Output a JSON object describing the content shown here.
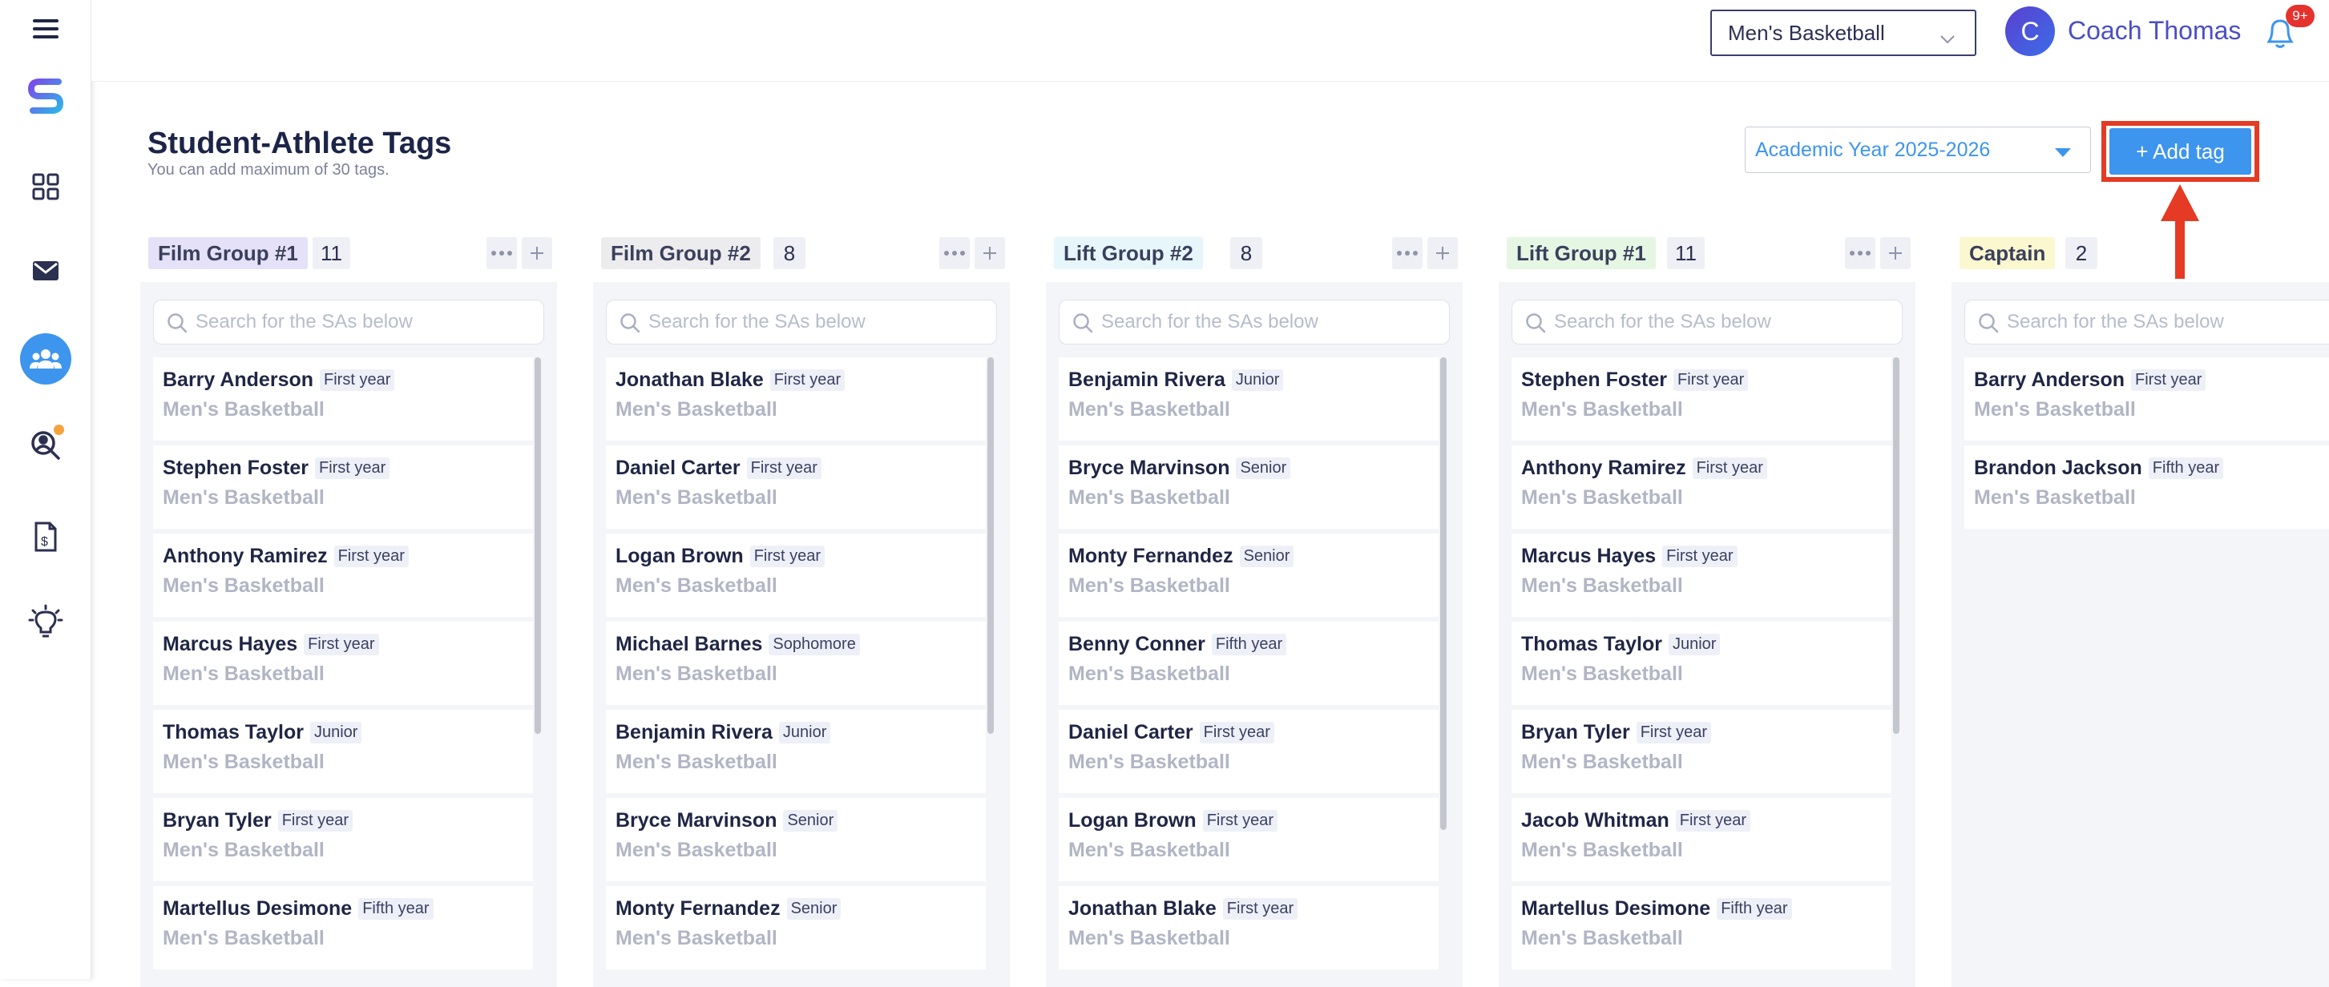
{
  "topbar": {
    "team_select": "Men's Basketball",
    "avatar_initial": "C",
    "user_name": "Coach Thomas",
    "notification_badge": "9+"
  },
  "page": {
    "title": "Student-Athlete Tags",
    "subtitle": "You can add maximum of 30 tags.",
    "year_select": "Academic Year 2025-2026",
    "add_tag_label": "+ Add tag"
  },
  "search_placeholder": "Search for the SAs below",
  "colors": {
    "accent": "#3d95ee",
    "highlight": "#e53a23",
    "tag_film1": "#e4e1f8",
    "tag_film2": "#ecebee",
    "tag_lift2": "#e6f6fb",
    "tag_lift1": "#e5f6e3",
    "tag_captain": "#fbf7cf"
  },
  "columns": [
    {
      "tag": "Film Group #1",
      "count": "11",
      "athletes": [
        {
          "name": "Barry Anderson",
          "year": "First year",
          "team": "Men's Basketball"
        },
        {
          "name": "Stephen Foster",
          "year": "First year",
          "team": "Men's Basketball"
        },
        {
          "name": "Anthony Ramirez",
          "year": "First year",
          "team": "Men's Basketball"
        },
        {
          "name": "Marcus Hayes",
          "year": "First year",
          "team": "Men's Basketball"
        },
        {
          "name": "Thomas Taylor",
          "year": "Junior",
          "team": "Men's Basketball"
        },
        {
          "name": "Bryan Tyler",
          "year": "First year",
          "team": "Men's Basketball"
        },
        {
          "name": "Martellus Desimone",
          "year": "Fifth year",
          "team": "Men's Basketball"
        }
      ]
    },
    {
      "tag": "Film Group #2",
      "count": "8",
      "athletes": [
        {
          "name": "Jonathan Blake",
          "year": "First year",
          "team": "Men's Basketball"
        },
        {
          "name": "Daniel Carter",
          "year": "First year",
          "team": "Men's Basketball"
        },
        {
          "name": "Logan Brown",
          "year": "First year",
          "team": "Men's Basketball"
        },
        {
          "name": "Michael Barnes",
          "year": "Sophomore",
          "team": "Men's Basketball"
        },
        {
          "name": "Benjamin Rivera",
          "year": "Junior",
          "team": "Men's Basketball"
        },
        {
          "name": "Bryce Marvinson",
          "year": "Senior",
          "team": "Men's Basketball"
        },
        {
          "name": "Monty Fernandez",
          "year": "Senior",
          "team": "Men's Basketball"
        }
      ]
    },
    {
      "tag": "Lift Group #2",
      "count": "8",
      "athletes": [
        {
          "name": "Benjamin Rivera",
          "year": "Junior",
          "team": "Men's Basketball"
        },
        {
          "name": "Bryce Marvinson",
          "year": "Senior",
          "team": "Men's Basketball"
        },
        {
          "name": "Monty Fernandez",
          "year": "Senior",
          "team": "Men's Basketball"
        },
        {
          "name": "Benny Conner",
          "year": "Fifth year",
          "team": "Men's Basketball"
        },
        {
          "name": "Daniel Carter",
          "year": "First year",
          "team": "Men's Basketball"
        },
        {
          "name": "Logan Brown",
          "year": "First year",
          "team": "Men's Basketball"
        },
        {
          "name": "Jonathan Blake",
          "year": "First year",
          "team": "Men's Basketball"
        }
      ]
    },
    {
      "tag": "Lift Group #1",
      "count": "11",
      "athletes": [
        {
          "name": "Stephen Foster",
          "year": "First year",
          "team": "Men's Basketball"
        },
        {
          "name": "Anthony Ramirez",
          "year": "First year",
          "team": "Men's Basketball"
        },
        {
          "name": "Marcus Hayes",
          "year": "First year",
          "team": "Men's Basketball"
        },
        {
          "name": "Thomas Taylor",
          "year": "Junior",
          "team": "Men's Basketball"
        },
        {
          "name": "Bryan Tyler",
          "year": "First year",
          "team": "Men's Basketball"
        },
        {
          "name": "Jacob Whitman",
          "year": "First year",
          "team": "Men's Basketball"
        },
        {
          "name": "Martellus Desimone",
          "year": "Fifth year",
          "team": "Men's Basketball"
        }
      ]
    },
    {
      "tag": "Captain",
      "count": "2",
      "athletes": [
        {
          "name": "Barry Anderson",
          "year": "First year",
          "team": "Men's Basketball"
        },
        {
          "name": "Brandon Jackson",
          "year": "Fifth year",
          "team": "Men's Basketball"
        }
      ]
    }
  ]
}
